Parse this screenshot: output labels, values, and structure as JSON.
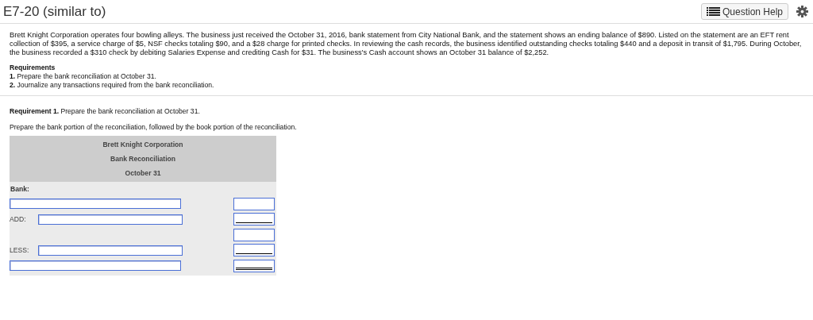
{
  "header": {
    "title": "E7-20 (similar to)",
    "help_button": "Question Help"
  },
  "problem": "Brett Knight Corporation operates four bowling alleys. The business just received the October 31, 2016, bank statement from City National Bank, and the statement shows an ending balance of $890. Listed on the statement are an EFT rent collection of $395, a service charge of $5, NSF checks totaling $90, and a $28 charge for printed checks. In reviewing the cash records, the business identified outstanding checks totaling $440 and a deposit in transit of $1,795. During October, the business recorded a $310 check by debiting Salaries Expense and crediting Cash for $31. The business's Cash account shows an October 31 balance of $2,252.",
  "requirements": {
    "heading": "Requirements",
    "items": [
      "**1.** Prepare the bank reconciliation at October 31.",
      "**2.** Journalize any transactions required from the bank reconciliation."
    ]
  },
  "requirement_1": "**Requirement 1.** Prepare the bank reconciliation at October 31.",
  "instruction": "Prepare the bank portion of the reconciliation, followed by the book portion of the reconciliation.",
  "reconciliation": {
    "title_lines": [
      "Brett Knight Corporation",
      "Bank Reconciliation",
      "October 31"
    ],
    "rows": [
      {
        "kind": "heading",
        "label": "Bank:"
      },
      {
        "kind": "entry",
        "left_field": true,
        "underline": false,
        "double_underline": false
      },
      {
        "kind": "entry",
        "label": "ADD:",
        "left_field": true,
        "underline": true,
        "double_underline": false
      },
      {
        "kind": "entry",
        "left_field": false,
        "underline": false,
        "double_underline": false
      },
      {
        "kind": "entry",
        "label": "LESS:",
        "left_field": true,
        "underline": true,
        "double_underline": false
      },
      {
        "kind": "entry",
        "left_field": true,
        "underline": true,
        "double_underline": true
      }
    ]
  }
}
